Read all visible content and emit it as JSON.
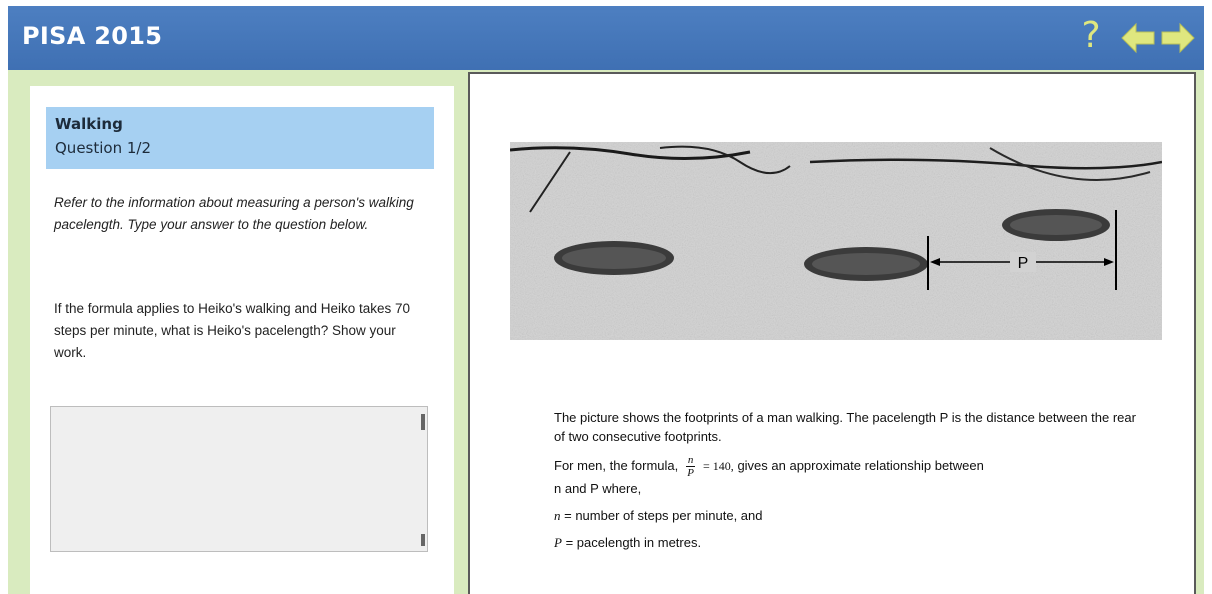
{
  "header": {
    "title": "PISA 2015",
    "help_label": "?",
    "icons": {
      "help": "help-icon",
      "back": "arrow-left-icon",
      "forward": "arrow-right-icon"
    },
    "colors": {
      "bar": "#4574b8",
      "icon": "#dfe77f"
    }
  },
  "left_panel": {
    "unit_title": "Walking",
    "question_number": "Question 1/2",
    "instruction": "Refer to the information about measuring a person's walking pacelength. Type your answer to the question below.",
    "question": "If the formula applies to Heiko's walking and Heiko takes 70 steps per minute, what is Heiko's pacelength?  Show your work.",
    "answer_value": ""
  },
  "stimulus": {
    "photo_label": "P",
    "p1": "The picture shows the footprints of a man walking. The pacelength P is the distance between the rear of two consecutive footprints.",
    "formula_intro": "For men, the formula,",
    "formula_num": "n",
    "formula_den": "P",
    "formula_rhs": "= 140,",
    "formula_outro": "gives an approximate relationship between",
    "formula_vars": "n and P where,",
    "def_n_var": "n",
    "def_n": "= number of steps per minute, and",
    "def_p_var": "P",
    "def_p": "= pacelength in metres."
  }
}
